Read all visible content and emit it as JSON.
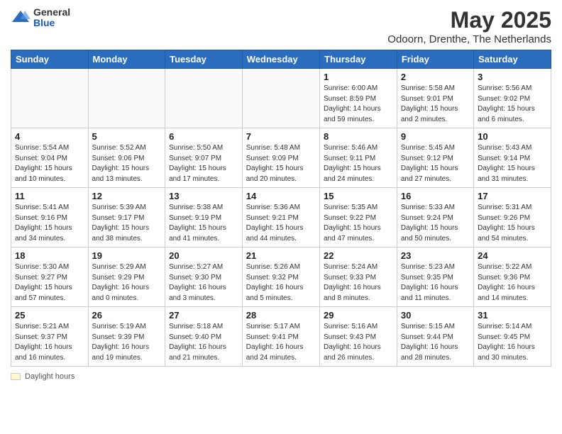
{
  "header": {
    "logo_general": "General",
    "logo_blue": "Blue",
    "title": "May 2025",
    "subtitle": "Odoorn, Drenthe, The Netherlands"
  },
  "days_of_week": [
    "Sunday",
    "Monday",
    "Tuesday",
    "Wednesday",
    "Thursday",
    "Friday",
    "Saturday"
  ],
  "weeks": [
    [
      {
        "day": "",
        "info": ""
      },
      {
        "day": "",
        "info": ""
      },
      {
        "day": "",
        "info": ""
      },
      {
        "day": "",
        "info": ""
      },
      {
        "day": "1",
        "info": "Sunrise: 6:00 AM\nSunset: 8:59 PM\nDaylight: 14 hours\nand 59 minutes."
      },
      {
        "day": "2",
        "info": "Sunrise: 5:58 AM\nSunset: 9:01 PM\nDaylight: 15 hours\nand 2 minutes."
      },
      {
        "day": "3",
        "info": "Sunrise: 5:56 AM\nSunset: 9:02 PM\nDaylight: 15 hours\nand 6 minutes."
      }
    ],
    [
      {
        "day": "4",
        "info": "Sunrise: 5:54 AM\nSunset: 9:04 PM\nDaylight: 15 hours\nand 10 minutes."
      },
      {
        "day": "5",
        "info": "Sunrise: 5:52 AM\nSunset: 9:06 PM\nDaylight: 15 hours\nand 13 minutes."
      },
      {
        "day": "6",
        "info": "Sunrise: 5:50 AM\nSunset: 9:07 PM\nDaylight: 15 hours\nand 17 minutes."
      },
      {
        "day": "7",
        "info": "Sunrise: 5:48 AM\nSunset: 9:09 PM\nDaylight: 15 hours\nand 20 minutes."
      },
      {
        "day": "8",
        "info": "Sunrise: 5:46 AM\nSunset: 9:11 PM\nDaylight: 15 hours\nand 24 minutes."
      },
      {
        "day": "9",
        "info": "Sunrise: 5:45 AM\nSunset: 9:12 PM\nDaylight: 15 hours\nand 27 minutes."
      },
      {
        "day": "10",
        "info": "Sunrise: 5:43 AM\nSunset: 9:14 PM\nDaylight: 15 hours\nand 31 minutes."
      }
    ],
    [
      {
        "day": "11",
        "info": "Sunrise: 5:41 AM\nSunset: 9:16 PM\nDaylight: 15 hours\nand 34 minutes."
      },
      {
        "day": "12",
        "info": "Sunrise: 5:39 AM\nSunset: 9:17 PM\nDaylight: 15 hours\nand 38 minutes."
      },
      {
        "day": "13",
        "info": "Sunrise: 5:38 AM\nSunset: 9:19 PM\nDaylight: 15 hours\nand 41 minutes."
      },
      {
        "day": "14",
        "info": "Sunrise: 5:36 AM\nSunset: 9:21 PM\nDaylight: 15 hours\nand 44 minutes."
      },
      {
        "day": "15",
        "info": "Sunrise: 5:35 AM\nSunset: 9:22 PM\nDaylight: 15 hours\nand 47 minutes."
      },
      {
        "day": "16",
        "info": "Sunrise: 5:33 AM\nSunset: 9:24 PM\nDaylight: 15 hours\nand 50 minutes."
      },
      {
        "day": "17",
        "info": "Sunrise: 5:31 AM\nSunset: 9:26 PM\nDaylight: 15 hours\nand 54 minutes."
      }
    ],
    [
      {
        "day": "18",
        "info": "Sunrise: 5:30 AM\nSunset: 9:27 PM\nDaylight: 15 hours\nand 57 minutes."
      },
      {
        "day": "19",
        "info": "Sunrise: 5:29 AM\nSunset: 9:29 PM\nDaylight: 16 hours\nand 0 minutes."
      },
      {
        "day": "20",
        "info": "Sunrise: 5:27 AM\nSunset: 9:30 PM\nDaylight: 16 hours\nand 3 minutes."
      },
      {
        "day": "21",
        "info": "Sunrise: 5:26 AM\nSunset: 9:32 PM\nDaylight: 16 hours\nand 5 minutes."
      },
      {
        "day": "22",
        "info": "Sunrise: 5:24 AM\nSunset: 9:33 PM\nDaylight: 16 hours\nand 8 minutes."
      },
      {
        "day": "23",
        "info": "Sunrise: 5:23 AM\nSunset: 9:35 PM\nDaylight: 16 hours\nand 11 minutes."
      },
      {
        "day": "24",
        "info": "Sunrise: 5:22 AM\nSunset: 9:36 PM\nDaylight: 16 hours\nand 14 minutes."
      }
    ],
    [
      {
        "day": "25",
        "info": "Sunrise: 5:21 AM\nSunset: 9:37 PM\nDaylight: 16 hours\nand 16 minutes."
      },
      {
        "day": "26",
        "info": "Sunrise: 5:19 AM\nSunset: 9:39 PM\nDaylight: 16 hours\nand 19 minutes."
      },
      {
        "day": "27",
        "info": "Sunrise: 5:18 AM\nSunset: 9:40 PM\nDaylight: 16 hours\nand 21 minutes."
      },
      {
        "day": "28",
        "info": "Sunrise: 5:17 AM\nSunset: 9:41 PM\nDaylight: 16 hours\nand 24 minutes."
      },
      {
        "day": "29",
        "info": "Sunrise: 5:16 AM\nSunset: 9:43 PM\nDaylight: 16 hours\nand 26 minutes."
      },
      {
        "day": "30",
        "info": "Sunrise: 5:15 AM\nSunset: 9:44 PM\nDaylight: 16 hours\nand 28 minutes."
      },
      {
        "day": "31",
        "info": "Sunrise: 5:14 AM\nSunset: 9:45 PM\nDaylight: 16 hours\nand 30 minutes."
      }
    ]
  ],
  "footer": {
    "daylight_label": "Daylight hours"
  }
}
